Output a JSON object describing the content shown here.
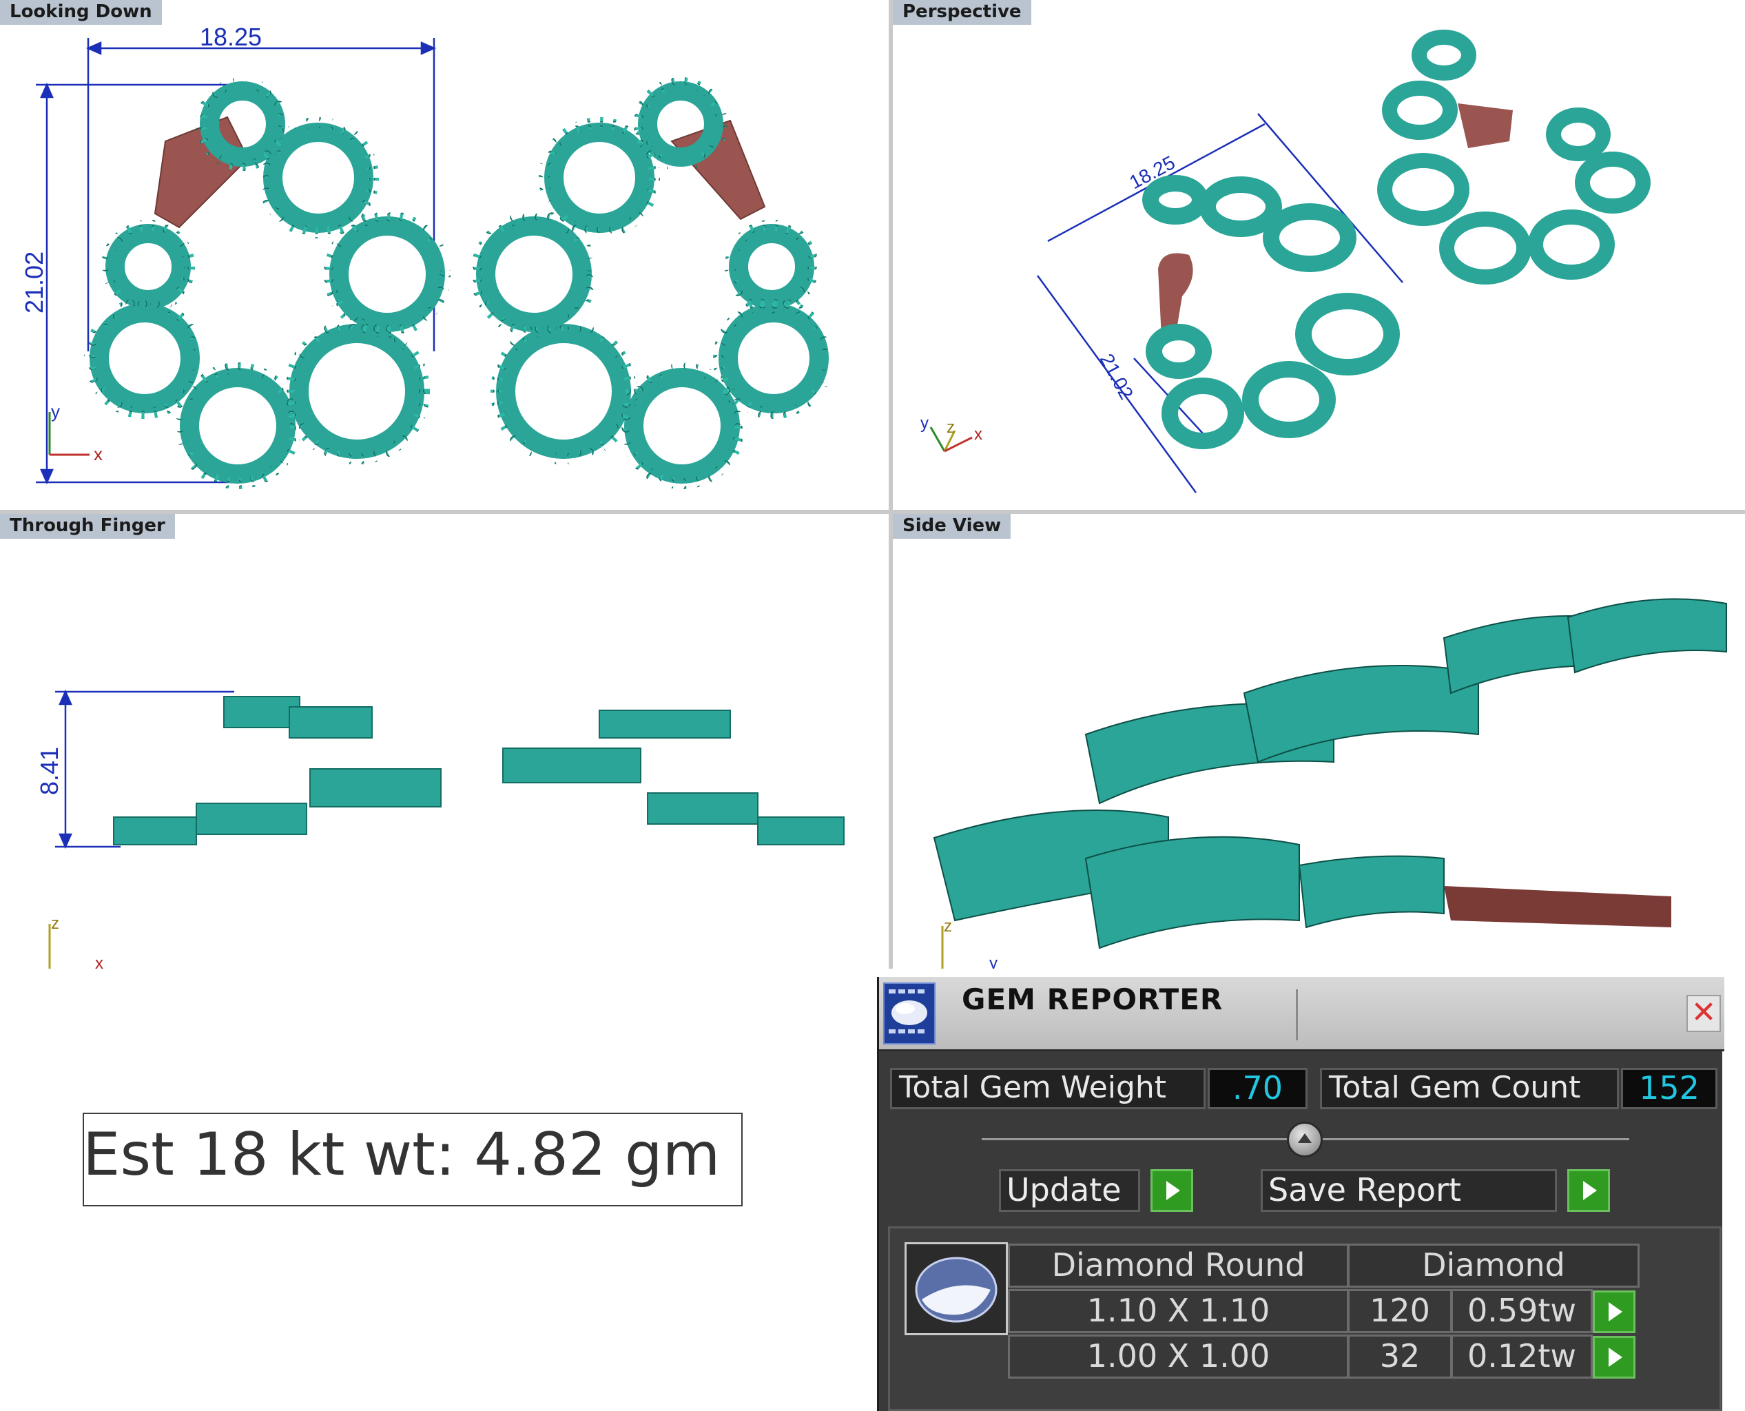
{
  "viewports": {
    "looking_down": {
      "title": "Looking Down",
      "dim_width": "18.25",
      "dim_height": "21.02",
      "axis_x": "x",
      "axis_y": "y"
    },
    "perspective": {
      "title": "Perspective",
      "dim_width": "18.25",
      "dim_height": "21.02",
      "axis_x": "x",
      "axis_y": "y",
      "axis_z": "z"
    },
    "through_finger": {
      "title": "Through Finger",
      "dim_height": "8.41",
      "axis_x": "x",
      "axis_z": "z"
    },
    "side_view": {
      "title": "Side View",
      "axis_z": "z",
      "axis_y": "y"
    }
  },
  "weight_label": "Est 18 kt wt: 4.82 gm",
  "gem_reporter": {
    "title": "GEM REPORTER",
    "close_symbol": "✕",
    "total_gem_weight_label": "Total Gem Weight",
    "total_gem_weight_value": ".70",
    "total_gem_count_label": "Total Gem Count",
    "total_gem_count_value": "152",
    "update_label": "Update",
    "save_report_label": "Save Report",
    "table": {
      "header_shape": "Diamond Round",
      "header_material": "Diamond",
      "rows": [
        {
          "size": "1.10 X 1.10",
          "count": "120",
          "weight": "0.59tw"
        },
        {
          "size": "1.00 X 1.00",
          "count": "32",
          "weight": "0.12tw"
        }
      ]
    }
  },
  "colors": {
    "metal_teal": "#2aa597",
    "gem_blue": "#5a6fa8",
    "link_red": "#9a5550",
    "dimension_blue": "#1b2fb8"
  }
}
